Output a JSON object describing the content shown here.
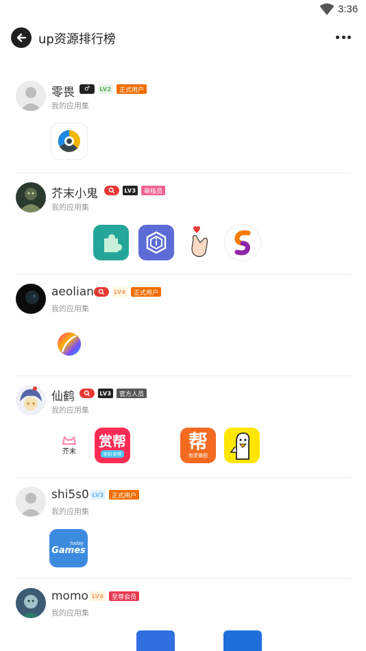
{
  "status": {
    "time": "3:36"
  },
  "header": {
    "title": "up资源排行榜"
  },
  "users": [
    {
      "name": "零畏",
      "subtitle": "我的应用集",
      "gender": "♂",
      "level": "LV2",
      "level_color": "#4caf50",
      "tag": "正式用户",
      "tag_color": "#ef6c00"
    },
    {
      "name": "芥末小鬼",
      "subtitle": "我的应用集",
      "gender": "",
      "level": "LV3",
      "level_color": "#222222",
      "tag": "审核员",
      "tag_color": "#f06292"
    },
    {
      "name": "aeolian",
      "subtitle": "我的应用集",
      "gender": "",
      "level": "LV4",
      "level_color": "#f4a261",
      "tag": "正式用户",
      "tag_color": "#ef6c00"
    },
    {
      "name": "仙鹤",
      "subtitle": "我的应用集",
      "gender": "",
      "level": "LV3",
      "level_color": "#222222",
      "tag": "官方人员",
      "tag_color": "#555555"
    },
    {
      "name": "shi5s0",
      "subtitle": "我的应用集",
      "gender": "",
      "level": "LV3",
      "level_color": "#64b5f6",
      "tag": "正式用户",
      "tag_color": "#ef6c00"
    },
    {
      "name": "momo",
      "subtitle": "我的应用集",
      "gender": "",
      "level": "LV4",
      "level_color": "#f4a261",
      "tag": "至尊会员",
      "tag_color": "#e53950"
    }
  ],
  "apps": {
    "shangbang": "赏帮",
    "shangbang_sub": "即刻·即得",
    "bang": "帮",
    "bang_sub": "有奖做图",
    "jiemo": "芥末",
    "games": "Games",
    "games_sub": "today"
  },
  "icons": [
    "wifi-icon",
    "back-arrow-icon",
    "more-icon"
  ]
}
